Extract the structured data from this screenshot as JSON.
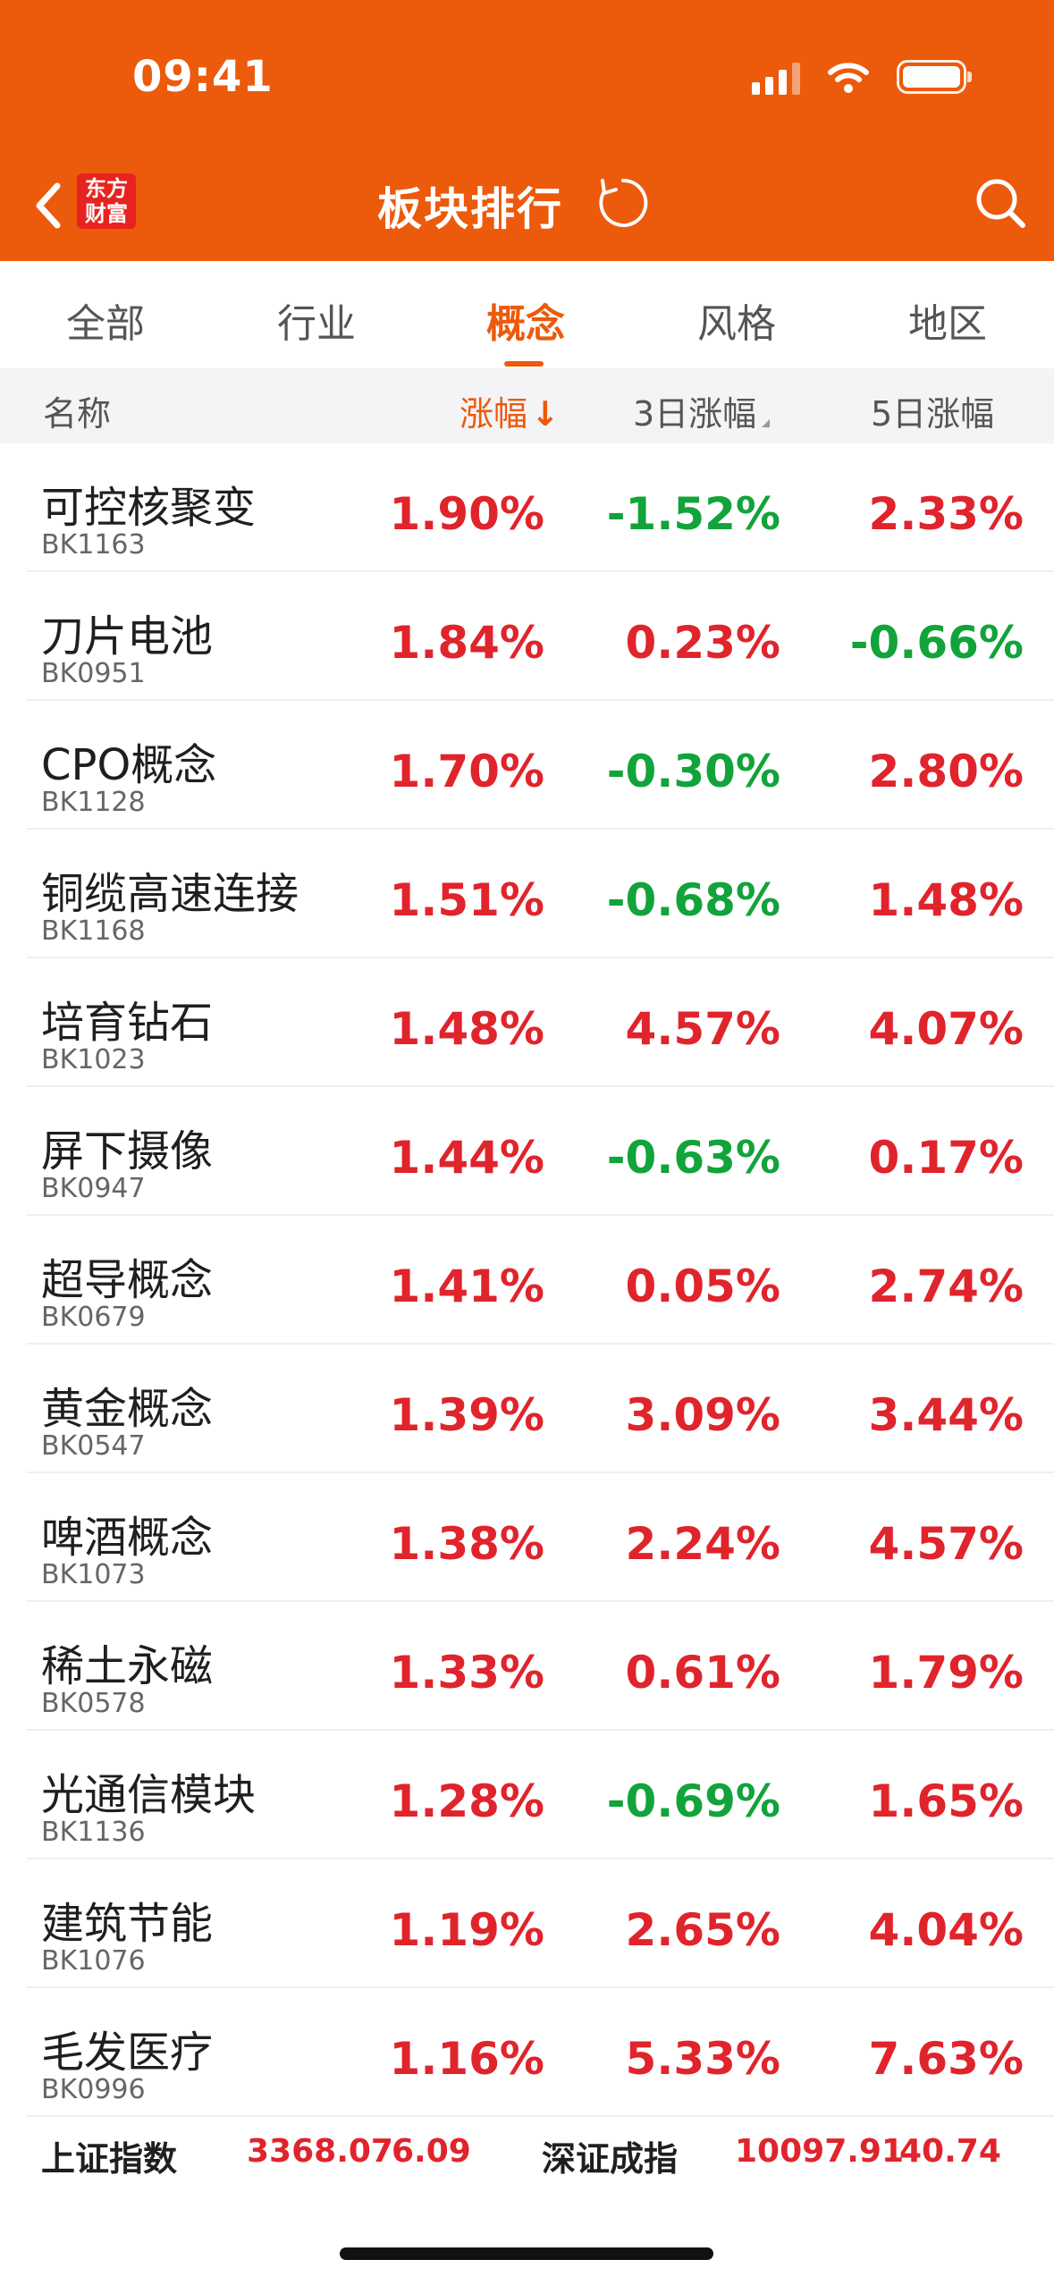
{
  "status_bar": {
    "time": "09:41"
  },
  "nav": {
    "title": "板块排行",
    "logo_line1": "东方",
    "logo_line2": "财富"
  },
  "tabs": [
    {
      "label": "全部",
      "active": false
    },
    {
      "label": "行业",
      "active": false
    },
    {
      "label": "概念",
      "active": true
    },
    {
      "label": "风格",
      "active": false
    },
    {
      "label": "地区",
      "active": false
    }
  ],
  "columns": {
    "name": "名称",
    "change": "涨幅",
    "change_sort_arrow": "↓",
    "change_3d": "3日涨幅",
    "change_5d": "5日涨幅"
  },
  "rows": [
    {
      "name": "可控核聚变",
      "code": "BK1163",
      "change": "1.90%",
      "change_3d": "-1.52%",
      "change_5d": "2.33%"
    },
    {
      "name": "刀片电池",
      "code": "BK0951",
      "change": "1.84%",
      "change_3d": "0.23%",
      "change_5d": "-0.66%"
    },
    {
      "name": "CPO概念",
      "code": "BK1128",
      "change": "1.70%",
      "change_3d": "-0.30%",
      "change_5d": "2.80%"
    },
    {
      "name": "铜缆高速连接",
      "code": "BK1168",
      "change": "1.51%",
      "change_3d": "-0.68%",
      "change_5d": "1.48%"
    },
    {
      "name": "培育钻石",
      "code": "BK1023",
      "change": "1.48%",
      "change_3d": "4.57%",
      "change_5d": "4.07%"
    },
    {
      "name": "屏下摄像",
      "code": "BK0947",
      "change": "1.44%",
      "change_3d": "-0.63%",
      "change_5d": "0.17%"
    },
    {
      "name": "超导概念",
      "code": "BK0679",
      "change": "1.41%",
      "change_3d": "0.05%",
      "change_5d": "2.74%"
    },
    {
      "name": "黄金概念",
      "code": "BK0547",
      "change": "1.39%",
      "change_3d": "3.09%",
      "change_5d": "3.44%"
    },
    {
      "name": "啤酒概念",
      "code": "BK1073",
      "change": "1.38%",
      "change_3d": "2.24%",
      "change_5d": "4.57%"
    },
    {
      "name": "稀土永磁",
      "code": "BK0578",
      "change": "1.33%",
      "change_3d": "0.61%",
      "change_5d": "1.79%"
    },
    {
      "name": "光通信模块",
      "code": "BK1136",
      "change": "1.28%",
      "change_3d": "-0.69%",
      "change_5d": "1.65%"
    },
    {
      "name": "建筑节能",
      "code": "BK1076",
      "change": "1.19%",
      "change_3d": "2.65%",
      "change_5d": "4.04%"
    },
    {
      "name": "毛发医疗",
      "code": "BK0996",
      "change": "1.16%",
      "change_3d": "5.33%",
      "change_5d": "7.63%"
    }
  ],
  "index_bar": {
    "sh_name": "上证指数",
    "sh_value": "3368.07",
    "sh_change": "6.09",
    "sz_name": "深证成指",
    "sz_value": "10097.91",
    "sz_change": "40.74"
  },
  "colors": {
    "brand": "#EC5A0C",
    "up": "#E0242C",
    "down": "#12A33B"
  },
  "icons": [
    "back-icon",
    "refresh-icon",
    "search-icon",
    "signal-icon",
    "wifi-icon",
    "battery-icon"
  ]
}
